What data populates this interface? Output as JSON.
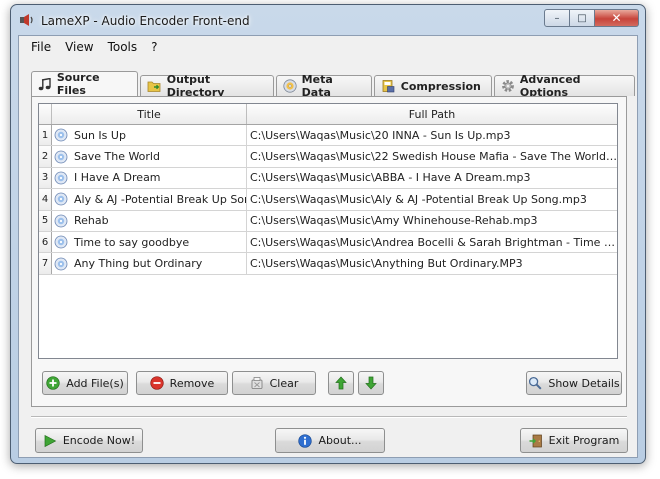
{
  "window": {
    "title": "LameXP - Audio Encoder Front-end",
    "minimize_glyph": "–",
    "maximize_glyph": "□",
    "close_glyph": "✕"
  },
  "menu": {
    "items": [
      "File",
      "View",
      "Tools",
      "?"
    ]
  },
  "tabs": [
    {
      "label": "Source Files",
      "icon": "music-note-icon",
      "active": true
    },
    {
      "label": "Output Directory",
      "icon": "folder-arrow-icon",
      "active": false
    },
    {
      "label": "Meta Data",
      "icon": "disc-icon",
      "active": false
    },
    {
      "label": "Compression",
      "icon": "book-icon",
      "active": false
    },
    {
      "label": "Advanced Options",
      "icon": "gear-icon",
      "active": false
    }
  ],
  "table": {
    "headers": {
      "title": "Title",
      "path": "Full Path"
    },
    "rows": [
      {
        "num": "1",
        "title": "Sun Is Up",
        "path": "C:\\Users\\Waqas\\Music\\20 INNA - Sun Is Up.mp3"
      },
      {
        "num": "2",
        "title": "Save The World",
        "path": "C:\\Users\\Waqas\\Music\\22 Swedish House Mafia - Save The World.mp3"
      },
      {
        "num": "3",
        "title": "I Have A Dream",
        "path": "C:\\Users\\Waqas\\Music\\ABBA - I Have A Dream.mp3"
      },
      {
        "num": "4",
        "title": "Aly & AJ -Potential Break Up Song",
        "path": "C:\\Users\\Waqas\\Music\\Aly & AJ -Potential Break Up Song.mp3"
      },
      {
        "num": "5",
        "title": "Rehab",
        "path": "C:\\Users\\Waqas\\Music\\Amy Whinehouse-Rehab.mp3"
      },
      {
        "num": "6",
        "title": "Time to say goodbye",
        "path": "C:\\Users\\Waqas\\Music\\Andrea Bocelli & Sarah Brightman - Time To Say ..."
      },
      {
        "num": "7",
        "title": "Any Thing but Ordinary",
        "path": "C:\\Users\\Waqas\\Music\\Anything But Ordinary.MP3"
      }
    ]
  },
  "buttons": {
    "add_files": "Add File(s)",
    "remove": "Remove",
    "clear": "Clear",
    "show_details": "Show Details",
    "encode_now": "Encode Now!",
    "about": "About...",
    "exit_program": "Exit Program"
  },
  "colors": {
    "titlebar": "#c9d9ea",
    "close_button": "#c7443a",
    "green_arrow": "#3fa535",
    "remove_red": "#d9342b",
    "info_blue": "#2f6fd0"
  }
}
